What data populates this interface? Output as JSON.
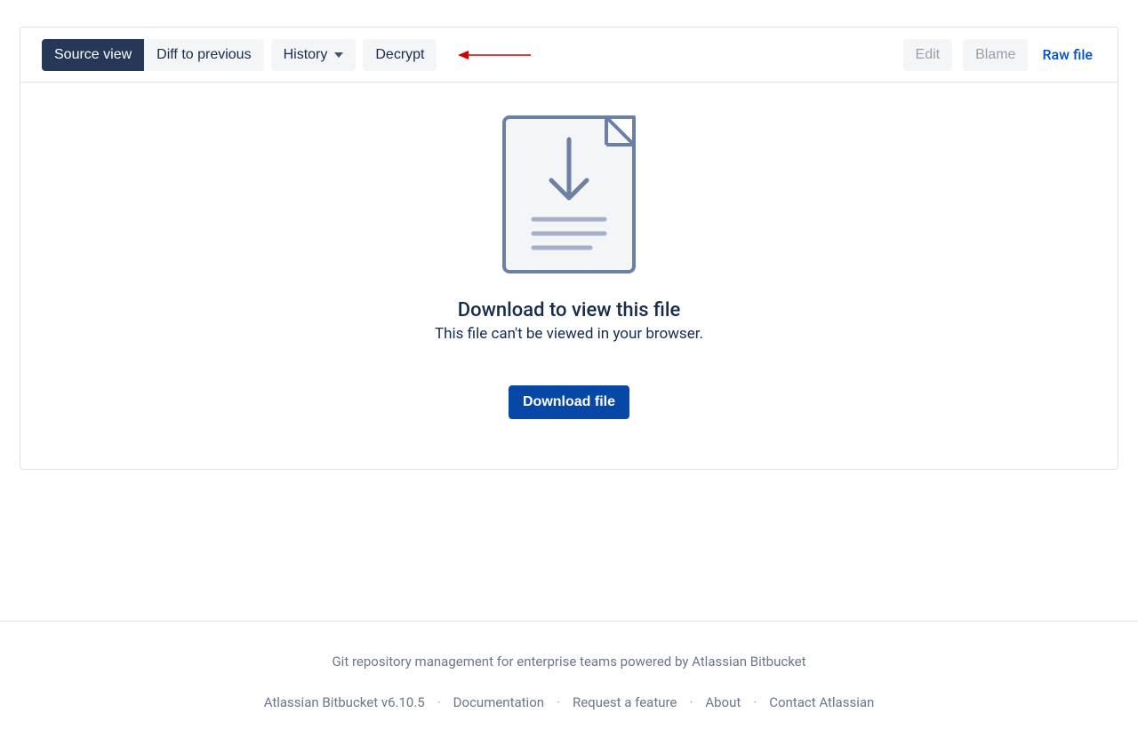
{
  "toolbar": {
    "source_view": "Source view",
    "diff_prev": "Diff to previous",
    "history": "History",
    "decrypt": "Decrypt",
    "edit": "Edit",
    "blame": "Blame",
    "raw_file": "Raw file"
  },
  "empty": {
    "title": "Download to view this file",
    "subtitle": "This file can't be viewed in your browser.",
    "download_btn": "Download file"
  },
  "footer": {
    "tagline": "Git repository management for enterprise teams powered by Atlassian Bitbucket",
    "version": "Atlassian Bitbucket v6.10.5",
    "documentation": "Documentation",
    "request_feature": "Request a feature",
    "about": "About",
    "contact": "Contact Atlassian"
  }
}
